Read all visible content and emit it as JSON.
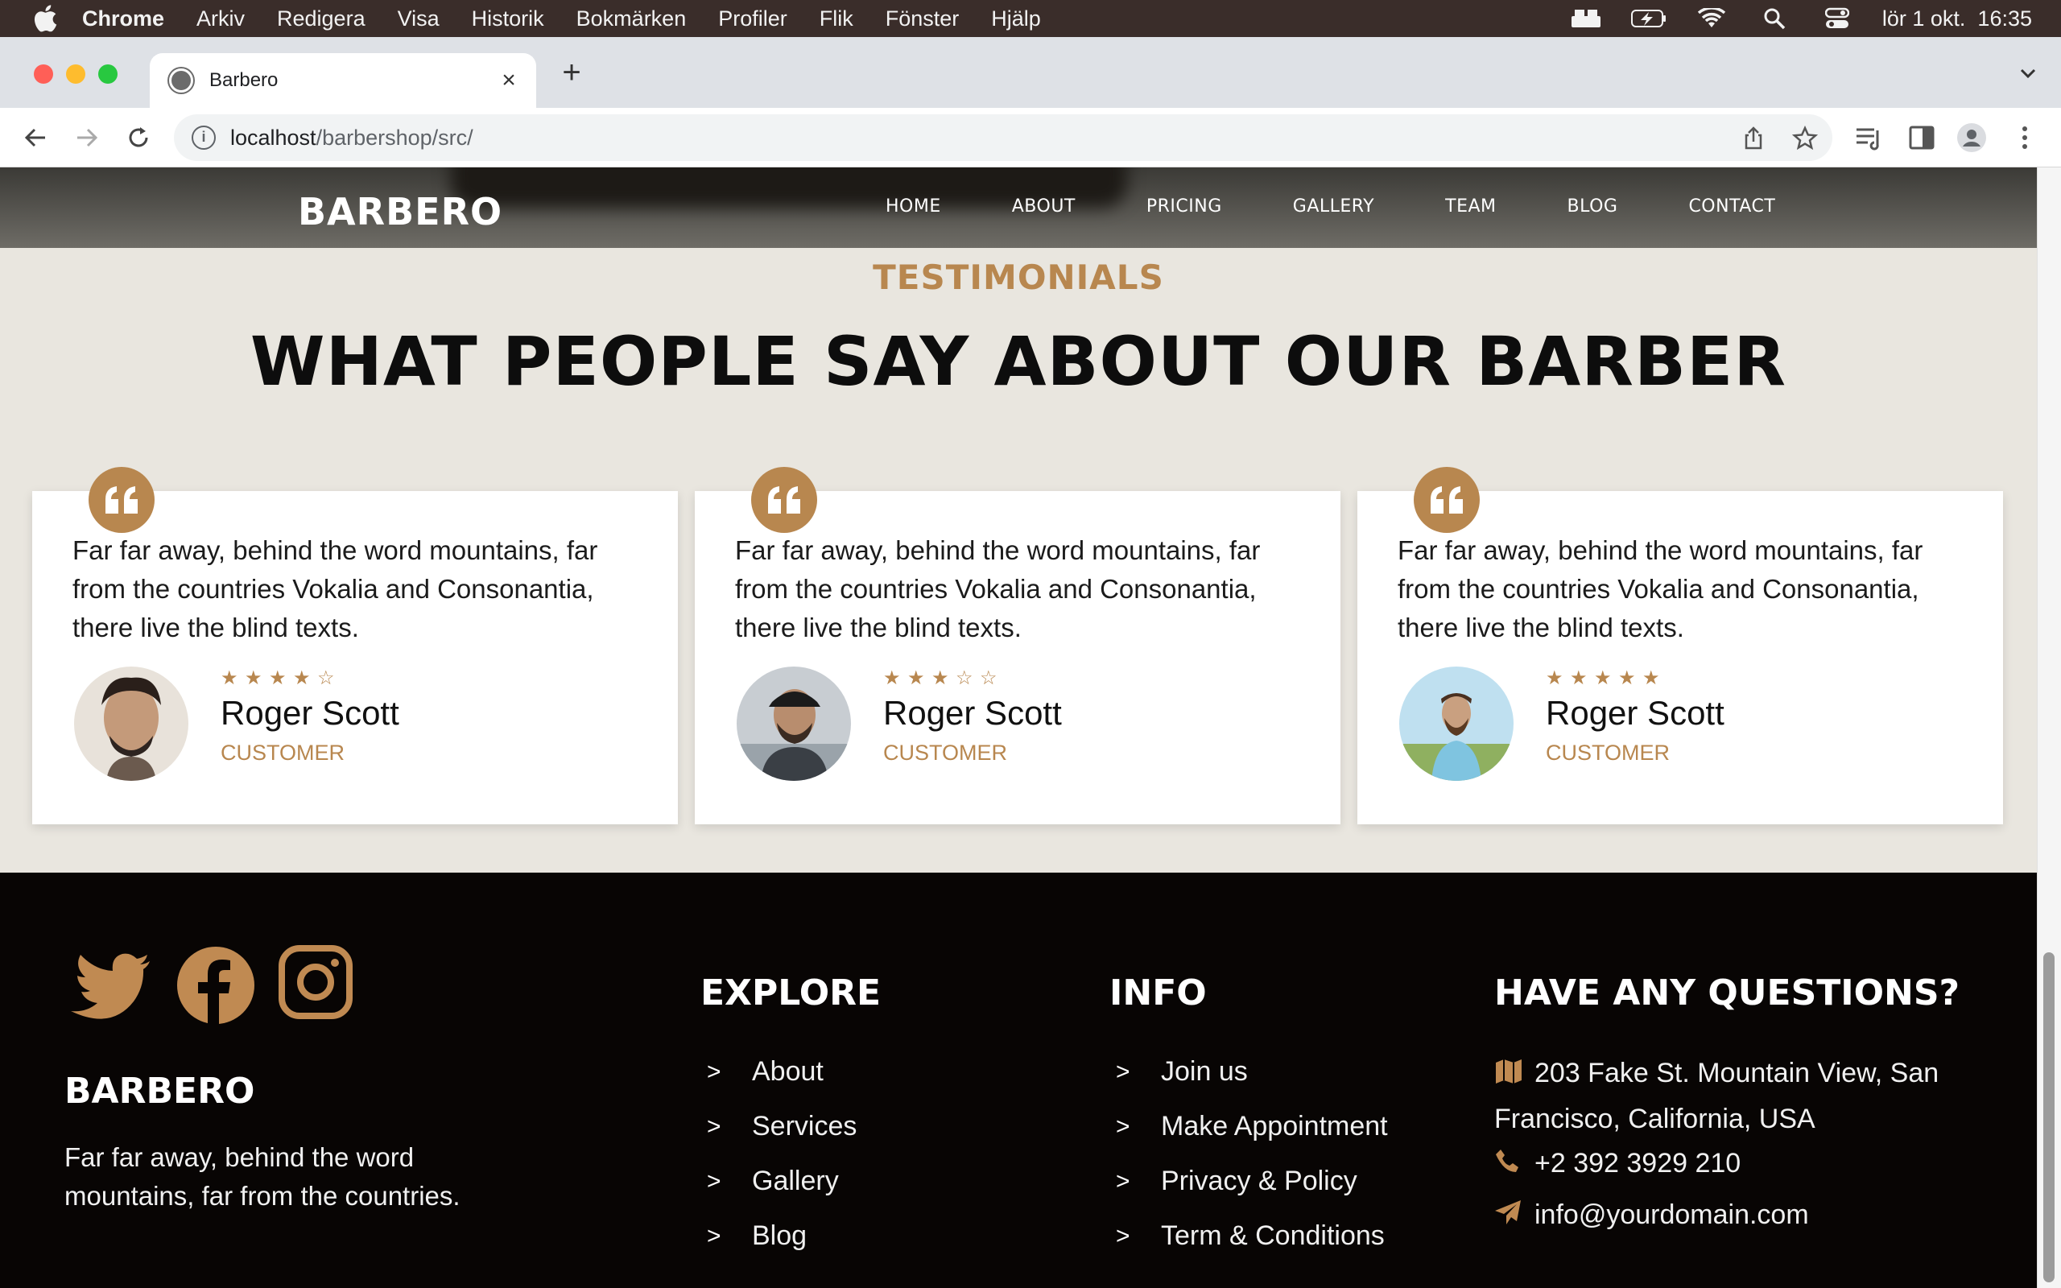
{
  "menubar": {
    "app": "Chrome",
    "items": [
      "Arkiv",
      "Redigera",
      "Visa",
      "Historik",
      "Bokmärken",
      "Profiler",
      "Flik",
      "Fönster",
      "Hjälp"
    ],
    "clock": "lör 1 okt.  16:35"
  },
  "browser": {
    "tab_title": "Barbero",
    "url_host": "localhost",
    "url_path": "/barbershop/src/"
  },
  "site": {
    "brand": "BARBERO",
    "nav": [
      "HOME",
      "ABOUT",
      "PRICING",
      "GALLERY",
      "TEAM",
      "BLOG",
      "CONTACT"
    ],
    "eyebrow": "TESTIMONIALS",
    "heading": "WHAT PEOPLE SAY ABOUT OUR BARBER",
    "testimonials": [
      {
        "text": "Far far away, behind the word mountains, far from the countries Vokalia and Consonantia, there live the blind texts.",
        "name": "Roger Scott",
        "role": "CUSTOMER",
        "rating": 4
      },
      {
        "text": "Far far away, behind the word mountains, far from the countries Vokalia and Consonantia, there live the blind texts.",
        "name": "Roger Scott",
        "role": "CUSTOMER",
        "rating": 3
      },
      {
        "text": "Far far away, behind the word mountains, far from the countries Vokalia and Consonantia, there live the blind texts.",
        "name": "Roger Scott",
        "role": "CUSTOMER",
        "rating": 5
      }
    ],
    "accent_color": "#b8874f"
  },
  "footer": {
    "brand": "BARBERO",
    "description": "Far far away, behind the word mountains, far from the countries.",
    "social": [
      "twitter-icon",
      "facebook-icon",
      "instagram-icon"
    ],
    "explore": {
      "title": "EXPLORE",
      "links": [
        "About",
        "Services",
        "Gallery",
        "Blog"
      ]
    },
    "info": {
      "title": "INFO",
      "links": [
        "Join us",
        "Make Appointment",
        "Privacy & Policy",
        "Term & Conditions"
      ]
    },
    "questions": {
      "title": "HAVE ANY QUESTIONS?",
      "address": "203 Fake St. Mountain View, San Francisco, California, USA",
      "phone": "+2 392 3929 210",
      "email": "info@yourdomain.com"
    }
  }
}
